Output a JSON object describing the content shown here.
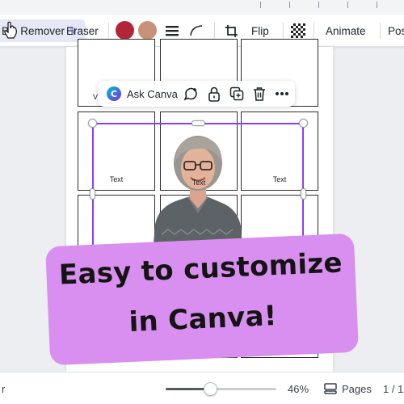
{
  "toolbar": {
    "bg_remover_label": "BG Remover",
    "eraser_label": "Eraser",
    "flip_label": "Flip",
    "animate_label": "Animate",
    "position_label": "Pos",
    "colors": {
      "swatch_1": "#b3263a",
      "swatch_2": "#c79278"
    },
    "icons": [
      "crown-icon",
      "line-weight-icon",
      "corner-rounding-icon",
      "crop-icon",
      "transparency-icon"
    ]
  },
  "floating_bar": {
    "ask_canva_label": "Ask Canva",
    "icons": [
      "canva-assistant-icon",
      "comment-icon",
      "lock-icon",
      "duplicate-icon",
      "trash-icon",
      "more-icon"
    ]
  },
  "canvas": {
    "partial_label": "Vis",
    "cell_label": "Text",
    "selection_color": "#8b3dff"
  },
  "banner": {
    "line1": "Easy to customize",
    "line2": "in Canva!",
    "color": "#d88ff0"
  },
  "status": {
    "left_label": "r",
    "zoom_value": "46%",
    "zoom_fraction": 0.4,
    "pages_label": "Pages",
    "page_count": "1 / 1"
  }
}
